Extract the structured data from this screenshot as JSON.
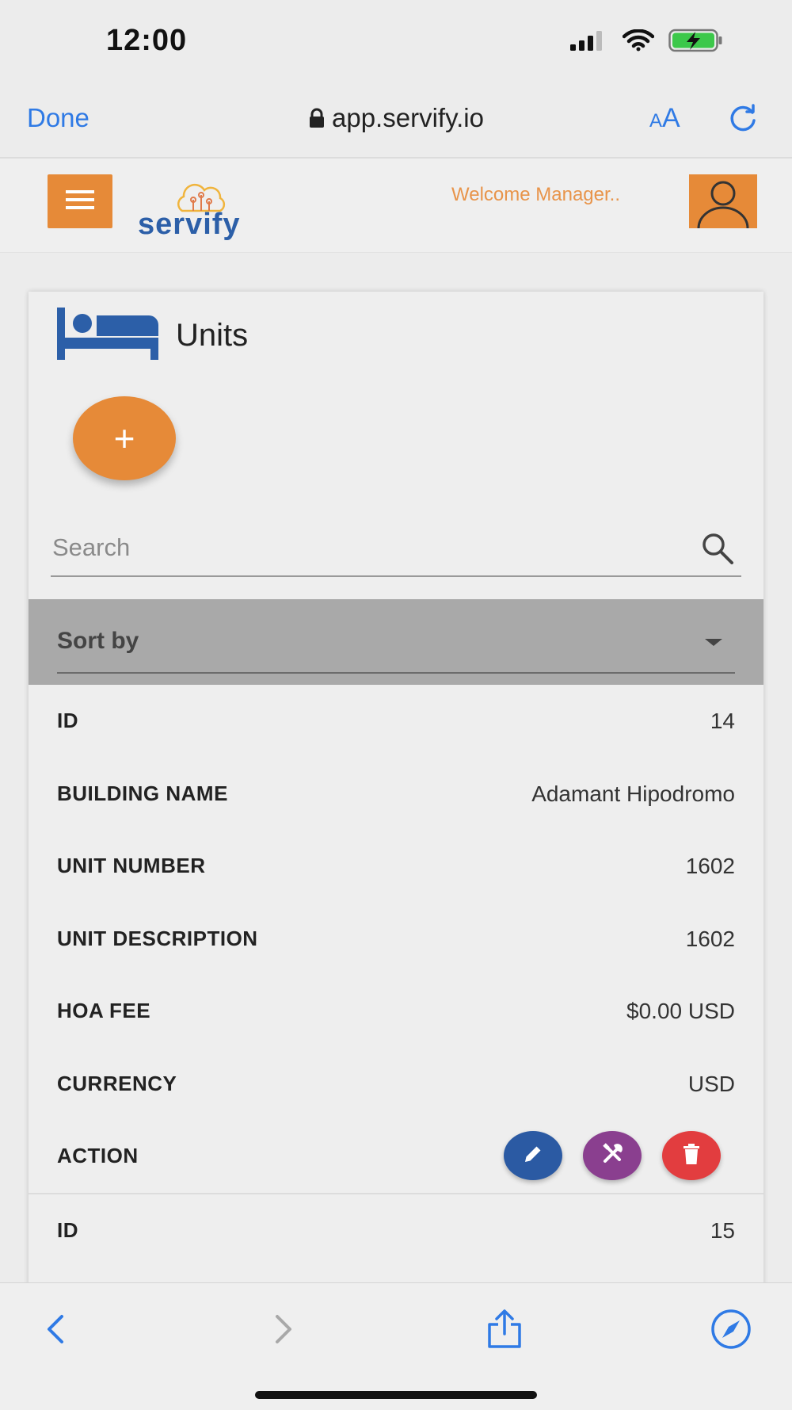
{
  "status_bar": {
    "time": "12:00"
  },
  "browser": {
    "done_label": "Done",
    "url": "app.servify.io",
    "aa_small": "A",
    "aa_large": "A"
  },
  "app_header": {
    "logo_text": "servify",
    "welcome_text": "Welcome Manager.."
  },
  "page": {
    "title": "Units",
    "add_label": "+",
    "search_placeholder": "Search",
    "sort_label": "Sort by"
  },
  "records": [
    {
      "fields": [
        {
          "key": "ID",
          "value": "14"
        },
        {
          "key": "BUILDING NAME",
          "value": "Adamant Hipodromo"
        },
        {
          "key": "UNIT NUMBER",
          "value": "1602"
        },
        {
          "key": "UNIT DESCRIPTION",
          "value": "1602"
        },
        {
          "key": "HOA FEE",
          "value": "$0.00 USD"
        },
        {
          "key": "CURRENCY",
          "value": "USD"
        }
      ],
      "action_label": "ACTION"
    },
    {
      "fields": [
        {
          "key": "ID",
          "value": "15"
        }
      ]
    }
  ],
  "colors": {
    "accent_orange": "#e68a38",
    "ios_blue": "#2f7ae5",
    "edit_blue": "#2b5aa3",
    "tools_purple": "#8a3f8f",
    "delete_red": "#e23d3f",
    "sort_bar_gray": "#a9a9a9"
  },
  "icons": [
    "signal-icon",
    "wifi-icon",
    "battery-icon",
    "lock-icon",
    "reload-icon",
    "hamburger-icon",
    "servify-logo-cloud-icon",
    "avatar-icon",
    "bed-icon",
    "search-icon",
    "chevron-down-icon",
    "pencil-icon",
    "tools-icon",
    "trash-icon",
    "back-arrow-icon",
    "forward-arrow-icon",
    "share-icon",
    "compass-icon"
  ]
}
